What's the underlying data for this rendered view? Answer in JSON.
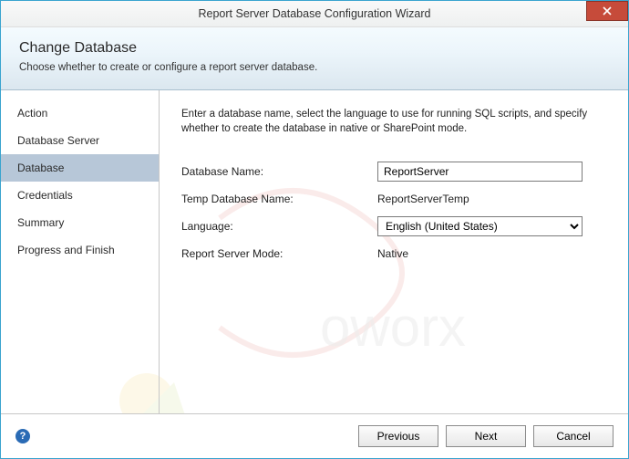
{
  "titlebar": {
    "title": "Report Server Database Configuration Wizard"
  },
  "header": {
    "title": "Change Database",
    "subtitle": "Choose whether to create or configure a report server database."
  },
  "sidebar": {
    "steps": [
      {
        "label": "Action",
        "active": false
      },
      {
        "label": "Database Server",
        "active": false
      },
      {
        "label": "Database",
        "active": true
      },
      {
        "label": "Credentials",
        "active": false
      },
      {
        "label": "Summary",
        "active": false
      },
      {
        "label": "Progress and Finish",
        "active": false
      }
    ]
  },
  "main": {
    "intro": "Enter a database name, select the language to use for running SQL scripts, and specify whether to create the database in native or SharePoint mode.",
    "fields": {
      "db_name_label": "Database Name:",
      "db_name_value": "ReportServer",
      "temp_db_label": "Temp Database Name:",
      "temp_db_value": "ReportServerTemp",
      "language_label": "Language:",
      "language_value": "English (United States)",
      "mode_label": "Report Server Mode:",
      "mode_value": "Native"
    }
  },
  "footer": {
    "help_glyph": "?",
    "previous": "Previous",
    "next": "Next",
    "cancel": "Cancel"
  }
}
